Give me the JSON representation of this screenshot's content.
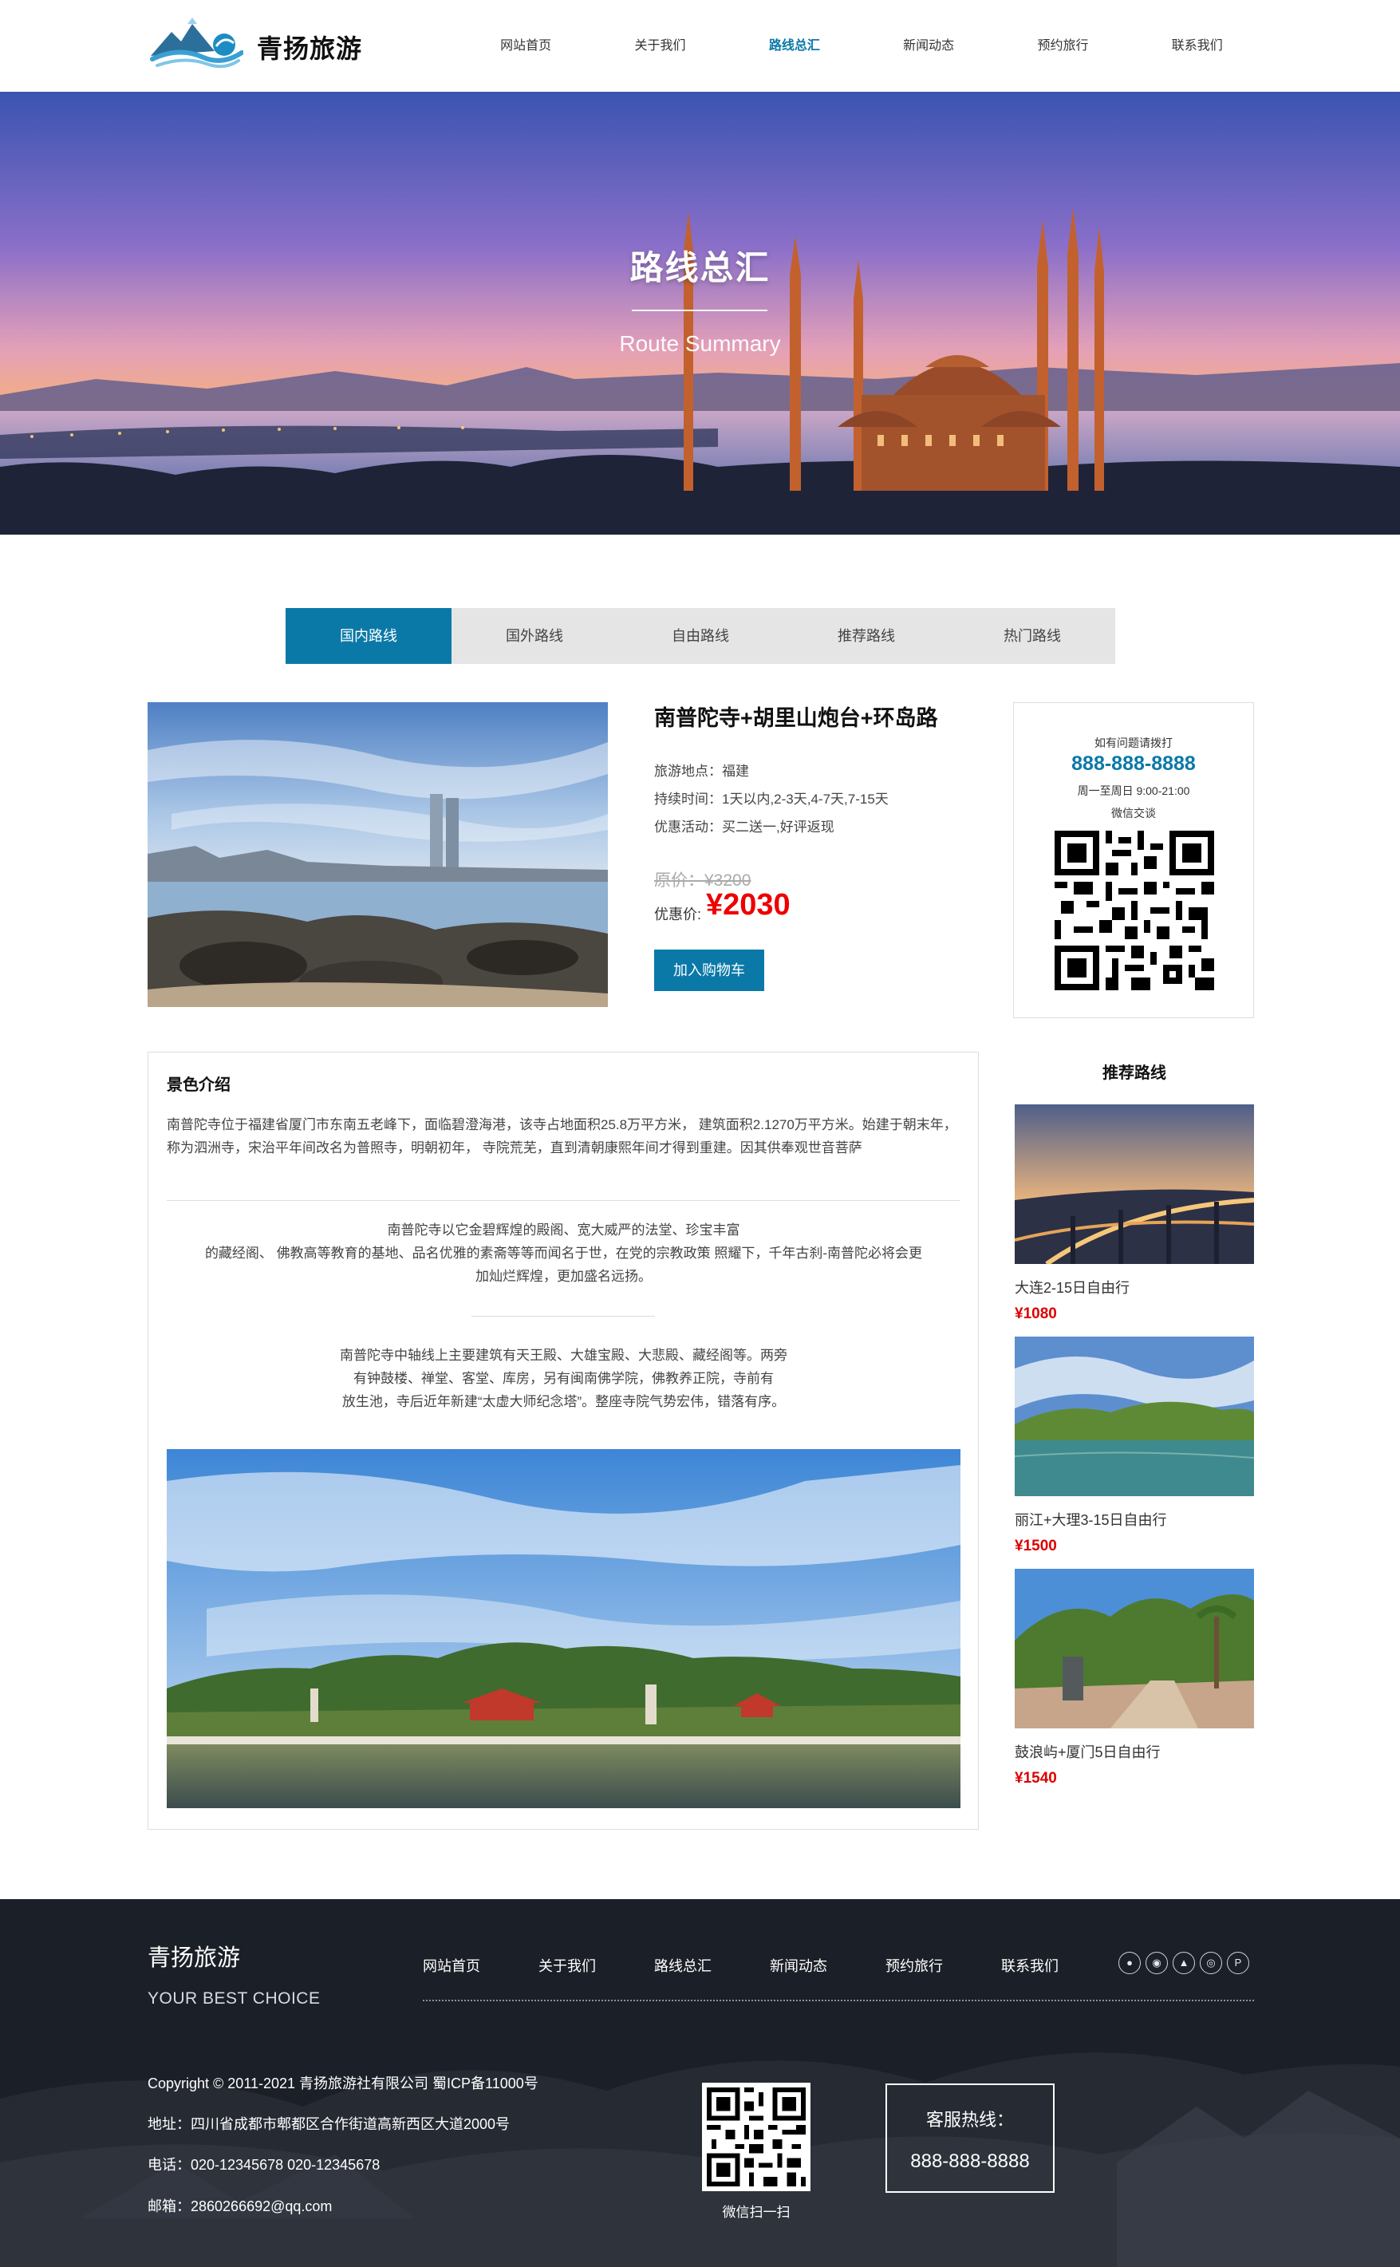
{
  "header": {
    "brand": "青扬旅游",
    "nav": [
      "网站首页",
      "关于我们",
      "路线总汇",
      "新闻动态",
      "预约旅行",
      "联系我们"
    ],
    "active_nav": "路线总汇"
  },
  "banner": {
    "title": "路线总汇",
    "subtitle": "Route Summary"
  },
  "tabs": [
    "国内路线",
    "国外路线",
    "自由路线",
    "推荐路线",
    "热门路线"
  ],
  "product": {
    "title": "南普陀寺+胡里山炮台+环岛路",
    "location": "旅游地点：福建",
    "duration": "持续时间：1天以内,2-3天,4-7天,7-15天",
    "promo": "优惠活动：买二送一,好评返现",
    "original_price": "原价：¥3200",
    "sale_label": "优惠价:",
    "sale_price": "¥2030",
    "cart_button": "加入购物车"
  },
  "contact": {
    "ask": "如有问题请拨打",
    "phone": "888-888-8888",
    "hours": "周一至周日 9:00-21:00",
    "wechat": "微信交谈"
  },
  "scenery": {
    "heading": "景色介绍",
    "p1": "南普陀寺位于福建省厦门市东南五老峰下，面临碧澄海港，该寺占地面积25.8万平方米， 建筑面积2.1270万平方米。始建于朝末年，称为泗洲寺，宋治平年间改名为普照寺，明朝初年， 寺院荒芜，直到清朝康熙年间才得到重建。因其供奉观世音菩萨",
    "p2_lines": [
      "南普陀寺以它金碧辉煌的殿阁、宽大威严的法堂、珍宝丰富",
      "的藏经阁、 佛教高等教育的基地、品名优雅的素斋等等而闻名于世，在党的宗教政策 照耀下，千年古刹-南普陀必将会更",
      "加灿烂辉煌，更加盛名远扬。"
    ],
    "p3_lines": [
      "南普陀寺中轴线上主要建筑有天王殿、大雄宝殿、大悲殿、藏经阁等。两旁",
      "有钟鼓楼、禅堂、客堂、库房，另有闽南佛学院，佛教养正院，寺前有",
      "放生池，寺后近年新建“太虚大师纪念塔”。整座寺院气势宏伟，错落有序。"
    ]
  },
  "recommend": {
    "title": "推荐路线",
    "items": [
      {
        "name": "大连2-15日自由行",
        "price": "¥1080"
      },
      {
        "name": "丽江+大理3-15日自由行",
        "price": "¥1500"
      },
      {
        "name": "鼓浪屿+厦门5日自由行",
        "price": "¥1540"
      }
    ]
  },
  "footer": {
    "brand": "青扬旅游",
    "slogan": "YOUR BEST CHOICE",
    "nav": [
      "网站首页",
      "关于我们",
      "路线总汇",
      "新闻动态",
      "预约旅行",
      "联系我们"
    ],
    "copyright": "Copyright © 2011-2021 青扬旅游社有限公司 蜀ICP备11000号",
    "address": "地址：四川省成都市郫都区合作街道高新西区大道2000号",
    "phone": "电话：020-12345678 020-12345678",
    "email": "邮箱：2860266692@qq.com",
    "qr_caption": "微信扫一扫",
    "hotline_label": "客服热线：",
    "hotline_number": "888-888-8888"
  },
  "colors": {
    "accent": "#0b79a8",
    "price": "#e00000",
    "tab_bg": "#e5e5e5",
    "footer_bg": "#1a1d24"
  },
  "icons": [
    "qq-icon",
    "wechat-icon",
    "person-icon",
    "weibo-icon",
    "p-icon"
  ]
}
